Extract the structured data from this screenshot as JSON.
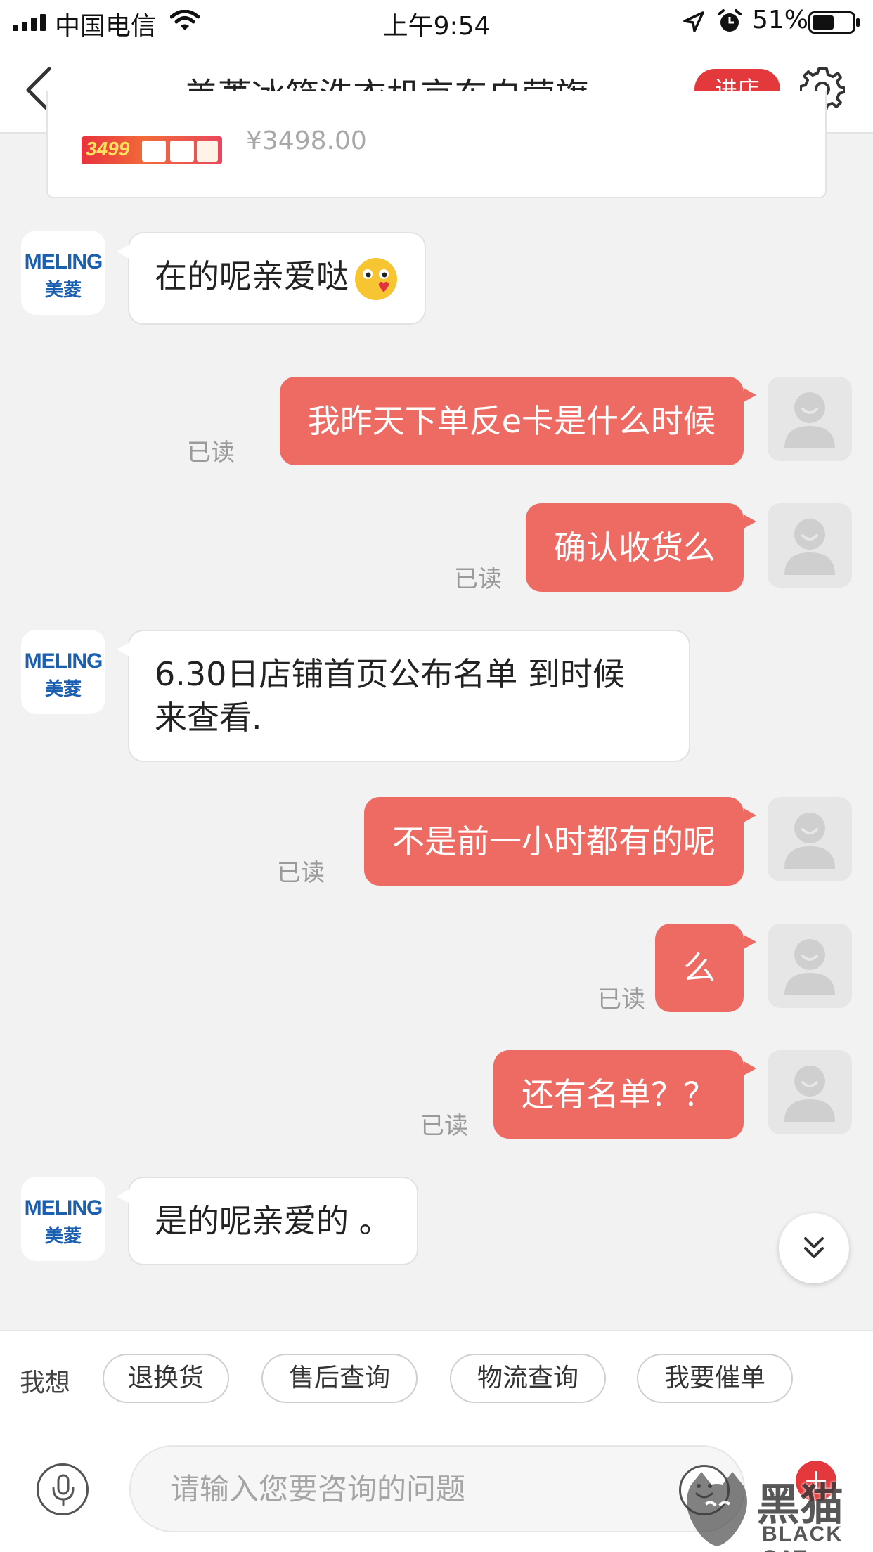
{
  "status_bar": {
    "carrier": "中国电信",
    "time": "上午9:54",
    "battery": "51%"
  },
  "nav": {
    "title": "美菱冰箱洗衣机京东自营旗…",
    "enter_shop": "进店"
  },
  "product": {
    "thumb_price": "3499",
    "price": "¥3498.00"
  },
  "shop_avatar": {
    "logo_en": "MELING",
    "logo_zh": "美菱"
  },
  "messages": [
    {
      "from": "shop",
      "text": "在的呢亲爱哒"
    },
    {
      "from": "me",
      "text": "我昨天下单反e卡是什么时候",
      "status": "已读"
    },
    {
      "from": "me",
      "text": "确认收货么",
      "status": "已读"
    },
    {
      "from": "shop",
      "line1": "6.30日店铺首页公布名单 到时候",
      "line2": "来查看."
    },
    {
      "from": "me",
      "text": "不是前一小时都有的呢",
      "status": "已读"
    },
    {
      "from": "me",
      "text": "么",
      "status": "已读"
    },
    {
      "from": "me",
      "text": "还有名单？？",
      "status": "已读"
    },
    {
      "from": "shop",
      "text": "是的呢亲爱的 。"
    }
  ],
  "quick_replies": {
    "label": "我想",
    "items": [
      "退换货",
      "售后查询",
      "物流查询",
      "我要催单"
    ]
  },
  "input": {
    "placeholder": "请输入您要咨询的问题"
  },
  "watermark": {
    "zh": "黑猫",
    "en": "BLACK CAT"
  },
  "colors": {
    "accent": "#e4393c",
    "my_bubble": "#ee6b63",
    "shop_logo": "#1b5fb0",
    "background": "#f2f2f2"
  }
}
